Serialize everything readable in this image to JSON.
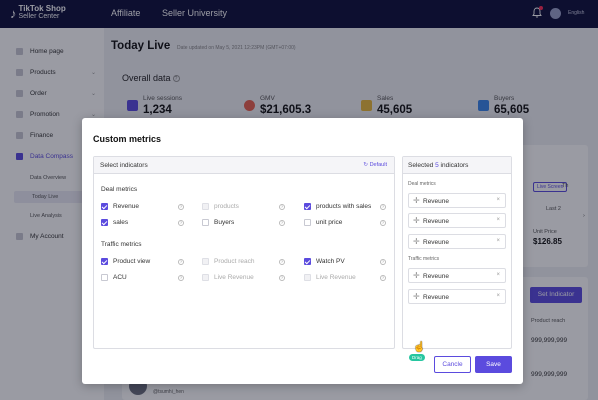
{
  "topbar": {
    "logo_line1": "TikTok Shop",
    "logo_line2": "Seller Center",
    "nav": [
      "Affiliate",
      "Seller University"
    ],
    "language": "English"
  },
  "sidebar": {
    "items": [
      {
        "label": "Home page"
      },
      {
        "label": "Products"
      },
      {
        "label": "Order"
      },
      {
        "label": "Promotion"
      },
      {
        "label": "Finance"
      },
      {
        "label": "Data Compass"
      },
      {
        "label": "My Account"
      }
    ],
    "subitems": [
      "Data Overview",
      "Today Live",
      "Live Analysis"
    ]
  },
  "main": {
    "title": "Today Live",
    "updated": "Date updated on May 5, 2021 12:23PM (GMT+07:00)",
    "overall_title": "Overall data",
    "metrics": [
      {
        "label": "Live sessions",
        "value": "1,234",
        "color": "#5b4bde"
      },
      {
        "label": "GMV",
        "value": "$21,605.3",
        "color": "#e8614f"
      },
      {
        "label": "Sales",
        "value": "45,605",
        "color": "#e9b93a"
      },
      {
        "label": "Buyers",
        "value": "65,605",
        "color": "#3a86e9"
      }
    ],
    "live_screen": "Live Screen",
    "th": "Th",
    "last2": "Last 2",
    "unit_price_label": "Unit Price",
    "unit_price_value": "$126.85",
    "set_indicator": "Set Indicator",
    "product_reach": "Product reach",
    "big_number_1": "999,999,999",
    "big_number_2": "999,999,999",
    "user_handle": "@tsumhi_hen"
  },
  "modal": {
    "title": "Custom metrics",
    "left_title": "Select  indicators",
    "default_label": "Default",
    "deal_title": "Deal metrics",
    "traffic_title": "Traffic metrics",
    "deal_options": [
      {
        "label": "Revenue",
        "state": "on"
      },
      {
        "label": "products",
        "state": "dis"
      },
      {
        "label": "products with sales",
        "state": "on"
      },
      {
        "label": "sales",
        "state": "on"
      },
      {
        "label": "Buyers",
        "state": "off"
      },
      {
        "label": "unit price",
        "state": "off"
      }
    ],
    "traffic_options": [
      {
        "label": "Product view",
        "state": "on"
      },
      {
        "label": "Product reach",
        "state": "dis"
      },
      {
        "label": "Watch PV",
        "state": "on"
      },
      {
        "label": "ACU",
        "state": "off"
      },
      {
        "label": "Live Revenue",
        "state": "dis"
      },
      {
        "label": "Live Revenue",
        "state": "dis"
      }
    ],
    "right_title_prefix": "Selected ",
    "right_count": "5",
    "right_title_suffix": " indicators",
    "right_deal_title": "Deal metrics",
    "right_traffic_title": "Traffic metrics",
    "selected_deal": [
      "Reveune",
      "Reveune",
      "Reveune"
    ],
    "selected_traffic": [
      "Reveune",
      "Reveune"
    ],
    "cancel_label": "Cancle",
    "save_label": "Save",
    "drag_label": "Drag"
  }
}
